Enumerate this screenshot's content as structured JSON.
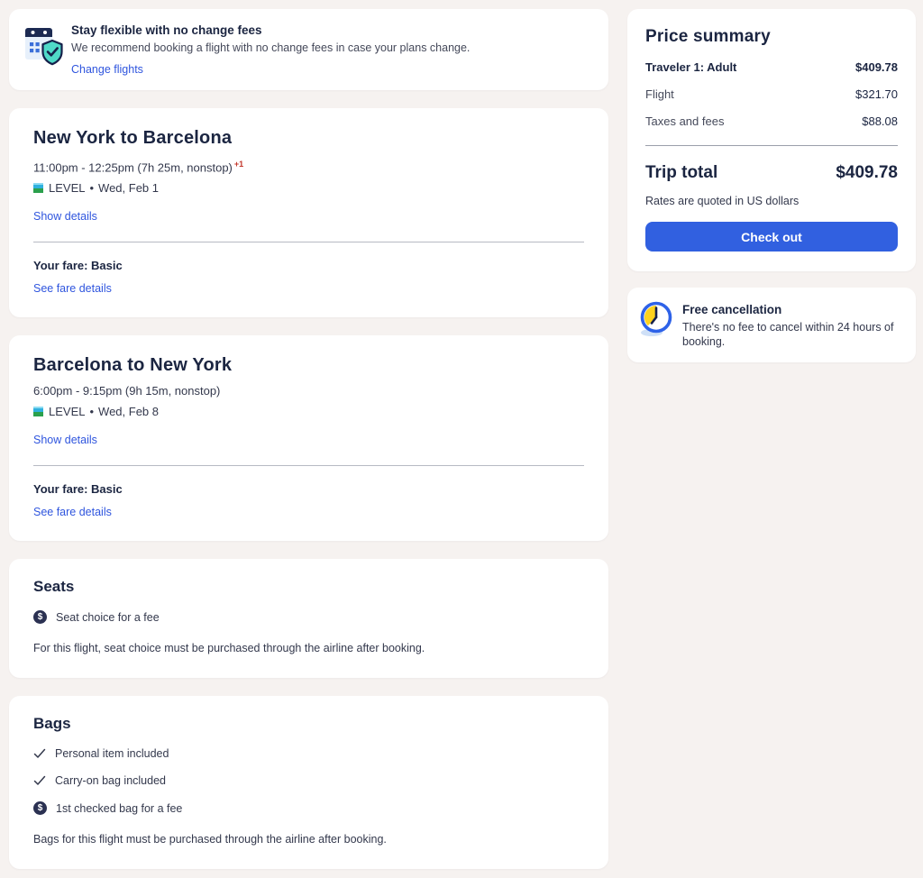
{
  "banner": {
    "title": "Stay flexible with no change fees",
    "description": "We recommend booking a flight with no change fees in case your plans change.",
    "link_label": "Change flights"
  },
  "flights": [
    {
      "title": "New York to Barcelona",
      "time": "11:00pm - 12:25pm (7h 25m, nonstop)",
      "day_offset": "+1",
      "airline": "LEVEL",
      "separator": "•",
      "date": "Wed, Feb 1",
      "show_details_label": "Show details",
      "fare_label": "Your fare: Basic",
      "fare_link_label": "See fare details"
    },
    {
      "title": "Barcelona to New York",
      "time": "6:00pm - 9:15pm (9h 15m, nonstop)",
      "day_offset": "",
      "airline": "LEVEL",
      "separator": "•",
      "date": "Wed, Feb 8",
      "show_details_label": "Show details",
      "fare_label": "Your fare: Basic",
      "fare_link_label": "See fare details"
    }
  ],
  "seats": {
    "title": "Seats",
    "fee_item": "Seat choice for a fee",
    "note": "For this flight, seat choice must be purchased through the airline after booking."
  },
  "bags": {
    "title": "Bags",
    "included_items": [
      "Personal item included",
      "Carry-on bag included"
    ],
    "fee_item": "1st checked bag for a fee",
    "note": "Bags for this flight must be purchased through the airline after booking."
  },
  "price_summary": {
    "title": "Price summary",
    "rows": [
      {
        "label": "Traveler 1: Adult",
        "value": "$409.78"
      },
      {
        "label": "Flight",
        "value": "$321.70"
      },
      {
        "label": "Taxes and fees",
        "value": "$88.08"
      }
    ],
    "total_label": "Trip total",
    "total_value": "$409.78",
    "rates_note": "Rates are quoted in US dollars",
    "checkout_label": "Check out"
  },
  "free_cancellation": {
    "title": "Free cancellation",
    "description": "There's no fee to cancel within 24 hours of booking."
  },
  "icons": {
    "dollar_glyph": "$"
  },
  "colors": {
    "page_background": "#f6f2f0",
    "card_background": "#ffffff",
    "primary_text": "#1b2541",
    "secondary_text": "#45495a",
    "link_blue": "#2f55de",
    "button_blue": "#3160e0",
    "alert_red": "#c3372c",
    "level_logo_cyan": "#2fb0de",
    "level_logo_green": "#2ba04c",
    "shield_teal": "#4fd9c8",
    "clock_yellow": "#ffd21e"
  }
}
